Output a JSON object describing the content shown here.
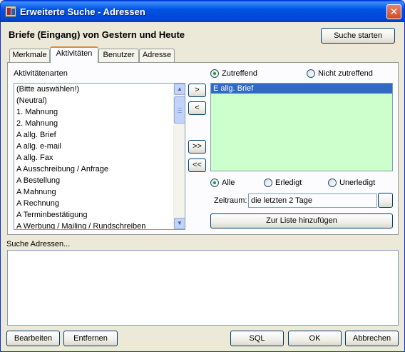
{
  "window": {
    "title": "Erweiterte Suche - Adressen",
    "close_glyph": "✕"
  },
  "header": {
    "title": "Briefe (Eingang) von Gestern und Heute",
    "start_search_label": "Suche starten"
  },
  "tabs": [
    {
      "label": "Merkmale"
    },
    {
      "label": "Aktivitäten"
    },
    {
      "label": "Benutzer"
    },
    {
      "label": "Adresse"
    }
  ],
  "activity_types": {
    "label": "Aktivitätenarten",
    "items": [
      "(Bitte auswählen!)",
      "(Neutral)",
      "1. Mahnung",
      "2. Mahnung",
      "A allg. Brief",
      "A allg. e-mail",
      "A allg. Fax",
      "A Ausschreibung / Anfrage",
      "A Bestellung",
      "A Mahnung",
      "A Rechnung",
      "A Terminbestätigung",
      "A Werbung / Mailing / Rundschreiben"
    ]
  },
  "transfer_buttons": {
    "add": ">",
    "remove": "<",
    "add_all": ">>",
    "remove_all": "<<"
  },
  "match_options": {
    "matching": "Zutreffend",
    "not_matching": "Nicht zutreffend",
    "selected": "matching"
  },
  "selected_list": {
    "items": [
      "E allg. Brief"
    ],
    "background": "#ccffcc",
    "selection_color": "#316ac5"
  },
  "status_filter": {
    "all": "Alle",
    "done": "Erledigt",
    "open": "Unerledigt",
    "selected": "all"
  },
  "period": {
    "label": "Zeitraum:",
    "value": "die letzten 2 Tage"
  },
  "add_to_list_label": "Zur Liste hinzufügen",
  "search_addresses": {
    "label": "Suche Adressen..."
  },
  "footer": {
    "edit_label": "Bearbeiten",
    "remove_label": "Entfernen",
    "sql_label": "SQL",
    "ok_label": "OK",
    "cancel_label": "Abbrechen"
  },
  "colors": {
    "titlebar": "#0054e3",
    "dialog_bg": "#ece9d8",
    "active_tab_accent": "#e68b2c"
  },
  "icons": {
    "window": "app-icon",
    "scroll_up": "scroll-up-arrow-icon",
    "scroll_down": "scroll-down-arrow-icon"
  }
}
